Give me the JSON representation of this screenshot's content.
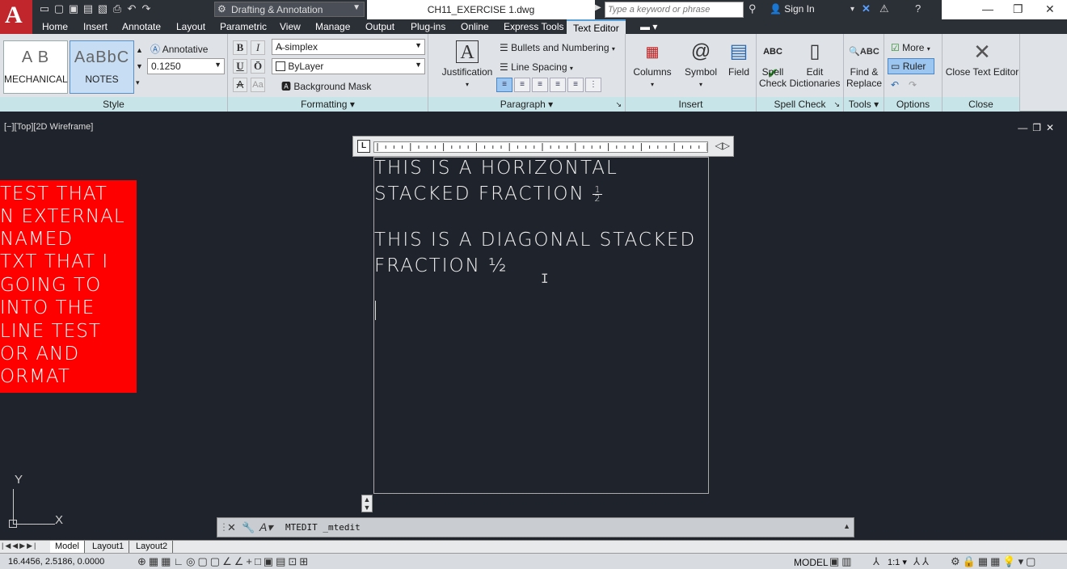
{
  "titlebar": {
    "app_logo": "A",
    "workspace": "Drafting & Annotation",
    "document_title": "CH11_EXERCISE 1.dwg",
    "search_placeholder": "Type a keyword or phrase",
    "sign_in": "Sign In"
  },
  "ribbon_tabs": [
    "Home",
    "Insert",
    "Annotate",
    "Layout",
    "Parametric",
    "View",
    "Manage",
    "Output",
    "Plug-ins",
    "Online",
    "Express Tools",
    "Text Editor"
  ],
  "active_tab": "Text Editor",
  "ribbon": {
    "style": {
      "title": "Style",
      "swatch1": {
        "sample": "A B",
        "name": "MECHANICAL"
      },
      "swatch2": {
        "sample": "AaBbC",
        "name": "NOTES"
      },
      "annotative": "Annotative",
      "height": "0.1250"
    },
    "formatting": {
      "title": "Formatting",
      "font": "simplex",
      "color": "ByLayer",
      "background_mask": "Background Mask",
      "bold": "B",
      "italic": "I",
      "underline": "U",
      "overline": "Ō",
      "strikethrough": "A",
      "case": "Aa"
    },
    "paragraph": {
      "title": "Paragraph",
      "justification": "Justification",
      "bullets": "Bullets and Numbering",
      "line_spacing": "Line Spacing"
    },
    "insert": {
      "title": "Insert",
      "columns": "Columns",
      "symbol": "Symbol",
      "field": "Field"
    },
    "spell": {
      "title": "Spell Check",
      "spell_check_l1": "Spell",
      "spell_check_l2": "Check",
      "edit_dict_l1": "Edit",
      "edit_dict_l2": "Dictionaries"
    },
    "tools": {
      "title": "Tools",
      "find_l1": "Find &",
      "find_l2": "Replace"
    },
    "options": {
      "title": "Options",
      "more": "More",
      "ruler": "Ruler"
    },
    "close": {
      "title": "Close",
      "close_text_editor": "Close Text Editor"
    }
  },
  "canvas": {
    "view_label": "[−][Top][2D Wireframe]",
    "red_block_lines": [
      "TEST THAT",
      "N EXTERNAL",
      " NAMED",
      "TXT THAT I",
      "GOING TO",
      " INTO THE",
      "LINE TEST",
      "OR AND",
      "ORMAT"
    ],
    "mtext": {
      "line1": "THIS IS A HORIZONTAL",
      "line2": "STACKED FRACTION",
      "frac_num": "1",
      "frac_den": "2",
      "line3": "THIS IS A DIAGONAL STACKED",
      "line4": "FRACTION",
      "diag_frac": "½"
    },
    "ucs_x": "X",
    "ucs_y": "Y"
  },
  "command_line": {
    "text": "MTEDIT _mtedit"
  },
  "layout_tabs": [
    "Model",
    "Layout1",
    "Layout2"
  ],
  "statusbar": {
    "coords": "16.4456, 2.5186, 0.0000",
    "model": "MODEL",
    "scale": "1:1"
  },
  "colors": {
    "canvas_bg": "#1f232b",
    "red_block": "#ff0000",
    "ribbon_bg": "#dfe3e8",
    "panel_title_bg": "#c7e5e8",
    "active_tab_border": "#5aa0d8"
  }
}
